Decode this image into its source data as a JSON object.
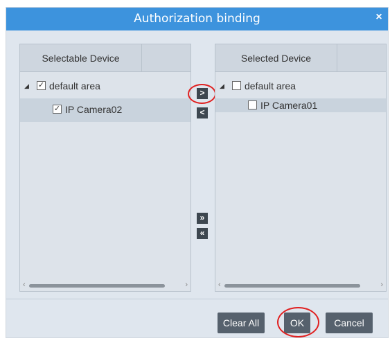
{
  "dialog": {
    "title": "Authorization binding",
    "close_symbol": "×"
  },
  "selectable": {
    "header": "Selectable Device",
    "items": [
      {
        "label": "default area",
        "checked": true,
        "expanded": true,
        "level": 0
      },
      {
        "label": "IP Camera02",
        "checked": true,
        "level": 1,
        "selected": true
      }
    ]
  },
  "selected": {
    "header": "Selected Device",
    "items": [
      {
        "label": "default area",
        "checked": false,
        "expanded": true,
        "level": 0
      },
      {
        "label": "IP Camera01",
        "checked": false,
        "level": 1,
        "selected": true
      }
    ]
  },
  "transfer": {
    "move_right": ">",
    "move_left": "<",
    "move_all_right": "»",
    "move_all_left": "«"
  },
  "buttons": {
    "clear_all": "Clear All",
    "ok": "OK",
    "cancel": "Cancel"
  },
  "colors": {
    "title_bar": "#3d93dd",
    "button": "#56616d",
    "highlight_ring": "#e02020"
  },
  "icons": {
    "expand": "triangle-down-icon",
    "checkbox": "checkbox-icon",
    "close": "close-icon"
  }
}
